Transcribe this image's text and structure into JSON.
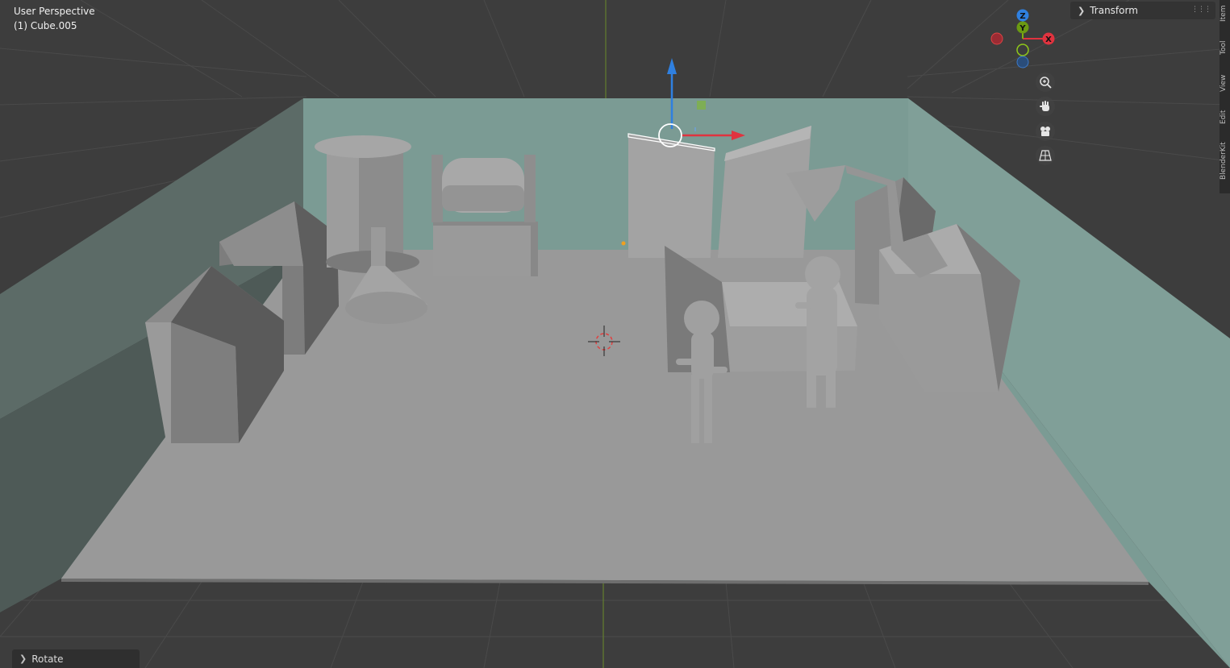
{
  "viewport": {
    "view_mode": "User Perspective",
    "active_object": "(1) Cube.005"
  },
  "sidebar": {
    "panel_title": "Transform",
    "tabs": [
      "Item",
      "Tool",
      "View",
      "Edit",
      "BlenderKit"
    ]
  },
  "gizmo": {
    "z_label": "Z",
    "y_label": "Y",
    "x_label": "X"
  },
  "navigation_tools": [
    "zoom-icon",
    "pan-hand-icon",
    "camera-icon",
    "perspective-grid-icon"
  ],
  "last_operation": {
    "label": "Rotate"
  },
  "colors": {
    "axis_x": "#e0333f",
    "axis_y": "#7fb10f",
    "axis_z": "#2f80e0",
    "wall": "#7b9b94",
    "floor": "#999999",
    "background": "#3d3d3d"
  }
}
